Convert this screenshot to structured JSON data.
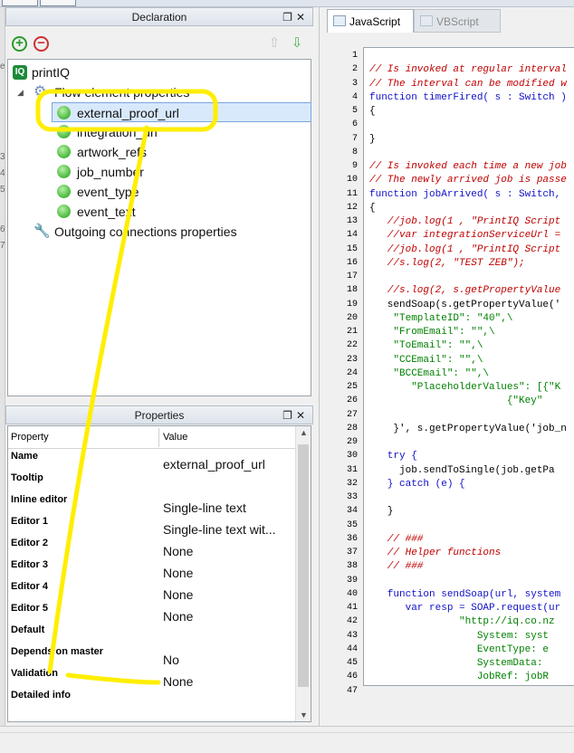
{
  "declaration": {
    "title": "Declaration",
    "tree": {
      "root": "printIQ",
      "flow_element_properties": "Flow element properties",
      "items": [
        "external_proof_url",
        "integration_url",
        "artwork_refs",
        "job_number",
        "event_type",
        "event_text"
      ],
      "selected": "external_proof_url",
      "outgoing": "Outgoing connections properties"
    }
  },
  "properties": {
    "title": "Properties",
    "columns": [
      "Property",
      "Value"
    ],
    "rows": [
      {
        "name": "Name",
        "value": "external_proof_url"
      },
      {
        "name": "Tooltip",
        "value": ""
      },
      {
        "name": "Inline editor",
        "value": "Single-line text"
      },
      {
        "name": "Editor 1",
        "value": "Single-line text wit..."
      },
      {
        "name": "Editor 2",
        "value": "None"
      },
      {
        "name": "Editor 3",
        "value": "None"
      },
      {
        "name": "Editor 4",
        "value": "None"
      },
      {
        "name": "Editor 5",
        "value": "None"
      },
      {
        "name": "Default",
        "value": ""
      },
      {
        "name": "Depends on master",
        "value": "No"
      },
      {
        "name": "Validation",
        "value": "None"
      },
      {
        "name": "Detailed info",
        "value": ""
      }
    ]
  },
  "editor": {
    "tabs": [
      "JavaScript",
      "VBScript"
    ],
    "active_tab": "JavaScript",
    "lines": [
      {
        "n": "1",
        "t": "",
        "k": "plain"
      },
      {
        "n": "2",
        "t": "// Is invoked at regular interval",
        "k": "comment"
      },
      {
        "n": "3",
        "t": "// The interval can be modified w",
        "k": "comment"
      },
      {
        "n": "4",
        "t": "function timerFired( s : Switch )",
        "k": "kw"
      },
      {
        "n": "5",
        "t": "{",
        "k": "plain"
      },
      {
        "n": "6",
        "t": "",
        "k": "plain"
      },
      {
        "n": "7",
        "t": "}",
        "k": "plain"
      },
      {
        "n": "8",
        "t": "",
        "k": "plain"
      },
      {
        "n": "9",
        "t": "// Is invoked each time a new job",
        "k": "comment"
      },
      {
        "n": "10",
        "t": "// The newly arrived job is passe",
        "k": "comment"
      },
      {
        "n": "11",
        "t": "function jobArrived( s : Switch, ",
        "k": "kw"
      },
      {
        "n": "12",
        "t": "{",
        "k": "plain"
      },
      {
        "n": "13",
        "t": "   //job.log(1 , \"PrintIQ Script",
        "k": "comment"
      },
      {
        "n": "14",
        "t": "   //var integrationServiceUrl =",
        "k": "comment"
      },
      {
        "n": "15",
        "t": "   //job.log(1 , \"PrintIQ Script",
        "k": "comment"
      },
      {
        "n": "16",
        "t": "   //s.log(2, \"TEST ZEB\");",
        "k": "comment"
      },
      {
        "n": "17",
        "t": "",
        "k": "plain"
      },
      {
        "n": "18",
        "t": "   //s.log(2, s.getPropertyValue",
        "k": "comment"
      },
      {
        "n": "19",
        "t": "   sendSoap(s.getPropertyValue('",
        "k": "plain"
      },
      {
        "n": "20",
        "t": "    \"TemplateID\": \"40\",\\",
        "k": "str"
      },
      {
        "n": "21",
        "t": "    \"FromEmail\": \"\",\\",
        "k": "str"
      },
      {
        "n": "22",
        "t": "    \"ToEmail\": \"\",\\",
        "k": "str"
      },
      {
        "n": "23",
        "t": "    \"CCEmail\": \"\",\\",
        "k": "str"
      },
      {
        "n": "24",
        "t": "    \"BCCEmail\": \"\",\\",
        "k": "str"
      },
      {
        "n": "25",
        "t": "       \"PlaceholderValues\": [{\"K",
        "k": "str"
      },
      {
        "n": "26",
        "t": "                       {\"Key\"",
        "k": "str"
      },
      {
        "n": "27",
        "t": "",
        "k": "plain"
      },
      {
        "n": "28",
        "t": "    }', s.getPropertyValue('job_n",
        "k": "plain"
      },
      {
        "n": "29",
        "t": "",
        "k": "plain"
      },
      {
        "n": "30",
        "t": "   try {",
        "k": "kw"
      },
      {
        "n": "31",
        "t": "     job.sendToSingle(job.getPa",
        "k": "plain"
      },
      {
        "n": "32",
        "t": "   } catch (e) {",
        "k": "kw"
      },
      {
        "n": "33",
        "t": "",
        "k": "plain"
      },
      {
        "n": "34",
        "t": "   }",
        "k": "plain"
      },
      {
        "n": "35",
        "t": "",
        "k": "plain"
      },
      {
        "n": "36",
        "t": "   // ###",
        "k": "comment"
      },
      {
        "n": "37",
        "t": "   // Helper functions",
        "k": "comment"
      },
      {
        "n": "38",
        "t": "   // ###",
        "k": "comment"
      },
      {
        "n": "39",
        "t": "",
        "k": "plain"
      },
      {
        "n": "40",
        "t": "   function sendSoap(url, system",
        "k": "kw"
      },
      {
        "n": "41",
        "t": "      var resp = SOAP.request(ur",
        "k": "kw"
      },
      {
        "n": "42",
        "t": "               \"http://iq.co.nz",
        "k": "str"
      },
      {
        "n": "43",
        "t": "                  System: syst",
        "k": "str"
      },
      {
        "n": "44",
        "t": "                  EventType: e",
        "k": "str"
      },
      {
        "n": "45",
        "t": "                  SystemData: ",
        "k": "str"
      },
      {
        "n": "46",
        "t": "                  JobRef: jobR",
        "k": "str"
      },
      {
        "n": "47",
        "t": "",
        "k": "plain"
      }
    ]
  },
  "gutter": {
    "marks": [
      "e",
      "",
      "3",
      "4",
      "5",
      "6",
      "7"
    ]
  },
  "colors": {
    "annotation": "#ffee00",
    "selection": "#d8e9fb",
    "comment": "#c00000",
    "keyword": "#1010c8",
    "string": "#008000"
  }
}
